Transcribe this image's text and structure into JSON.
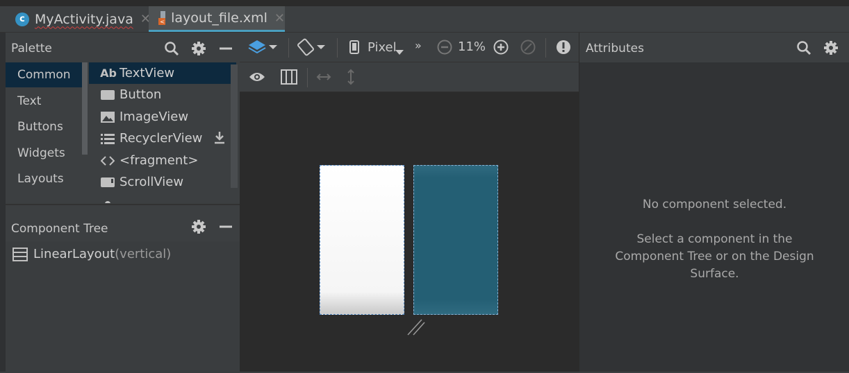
{
  "tabs": [
    {
      "icon": "java-class-icon",
      "label": "MyActivity.java"
    },
    {
      "icon": "xml-layout-icon",
      "label": "layout_file.xml"
    }
  ],
  "palette": {
    "title": "Palette",
    "categories": [
      "Common",
      "Text",
      "Buttons",
      "Widgets",
      "Layouts"
    ],
    "items": [
      {
        "icon": "textview-icon",
        "label": "TextView"
      },
      {
        "icon": "button-icon",
        "label": "Button"
      },
      {
        "icon": "imageview-icon",
        "label": "ImageView"
      },
      {
        "icon": "recyclerview-icon",
        "label": "RecyclerView"
      },
      {
        "icon": "fragment-icon",
        "label": "<fragment>"
      },
      {
        "icon": "scrollview-icon",
        "label": "ScrollView"
      }
    ],
    "textview_prefix": "Ab"
  },
  "component_tree": {
    "title": "Component Tree",
    "root": {
      "name": "LinearLayout",
      "detail": "(vertical)"
    }
  },
  "design_toolbar": {
    "device": "Pixel",
    "zoom": "11%",
    "overflow": "»"
  },
  "attributes": {
    "title": "Attributes",
    "empty_title": "No component selected.",
    "empty_lines": [
      "Select a component in the",
      "Component Tree or on the Design",
      "Surface."
    ]
  },
  "colors": {
    "selection": "#0d293e",
    "accent": "#4a9fbf",
    "blueprint": "#245f74"
  }
}
